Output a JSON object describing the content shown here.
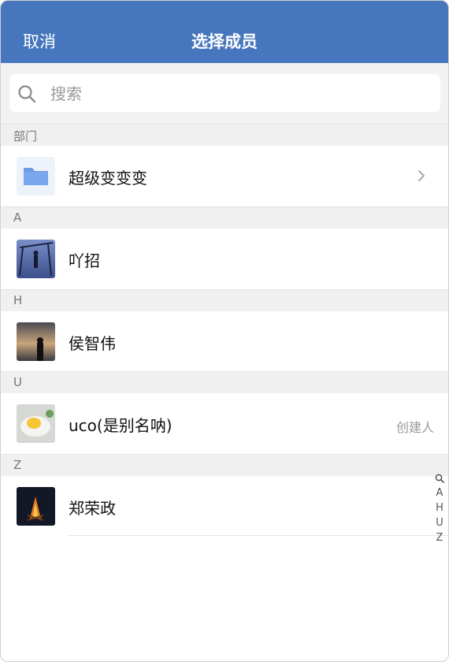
{
  "nav": {
    "cancel_label": "取消",
    "title": "选择成员"
  },
  "search": {
    "placeholder": "搜索",
    "value": ""
  },
  "sections": {
    "dept": "部门",
    "a": "A",
    "h": "H",
    "u": "U",
    "z": "Z"
  },
  "rows": {
    "dept_folder": {
      "name": "超级变变变",
      "icon": "folder-icon"
    },
    "member_a": {
      "name": "吖招"
    },
    "member_h": {
      "name": "侯智伟"
    },
    "member_u": {
      "name": "uco(是别名呐)",
      "tag": "创建人"
    },
    "member_z": {
      "name": "郑荣政"
    }
  },
  "index": {
    "letters": [
      "A",
      "H",
      "U",
      "Z"
    ]
  },
  "colors": {
    "nav_bg": "#4677be",
    "folder": "#6d9be6"
  }
}
